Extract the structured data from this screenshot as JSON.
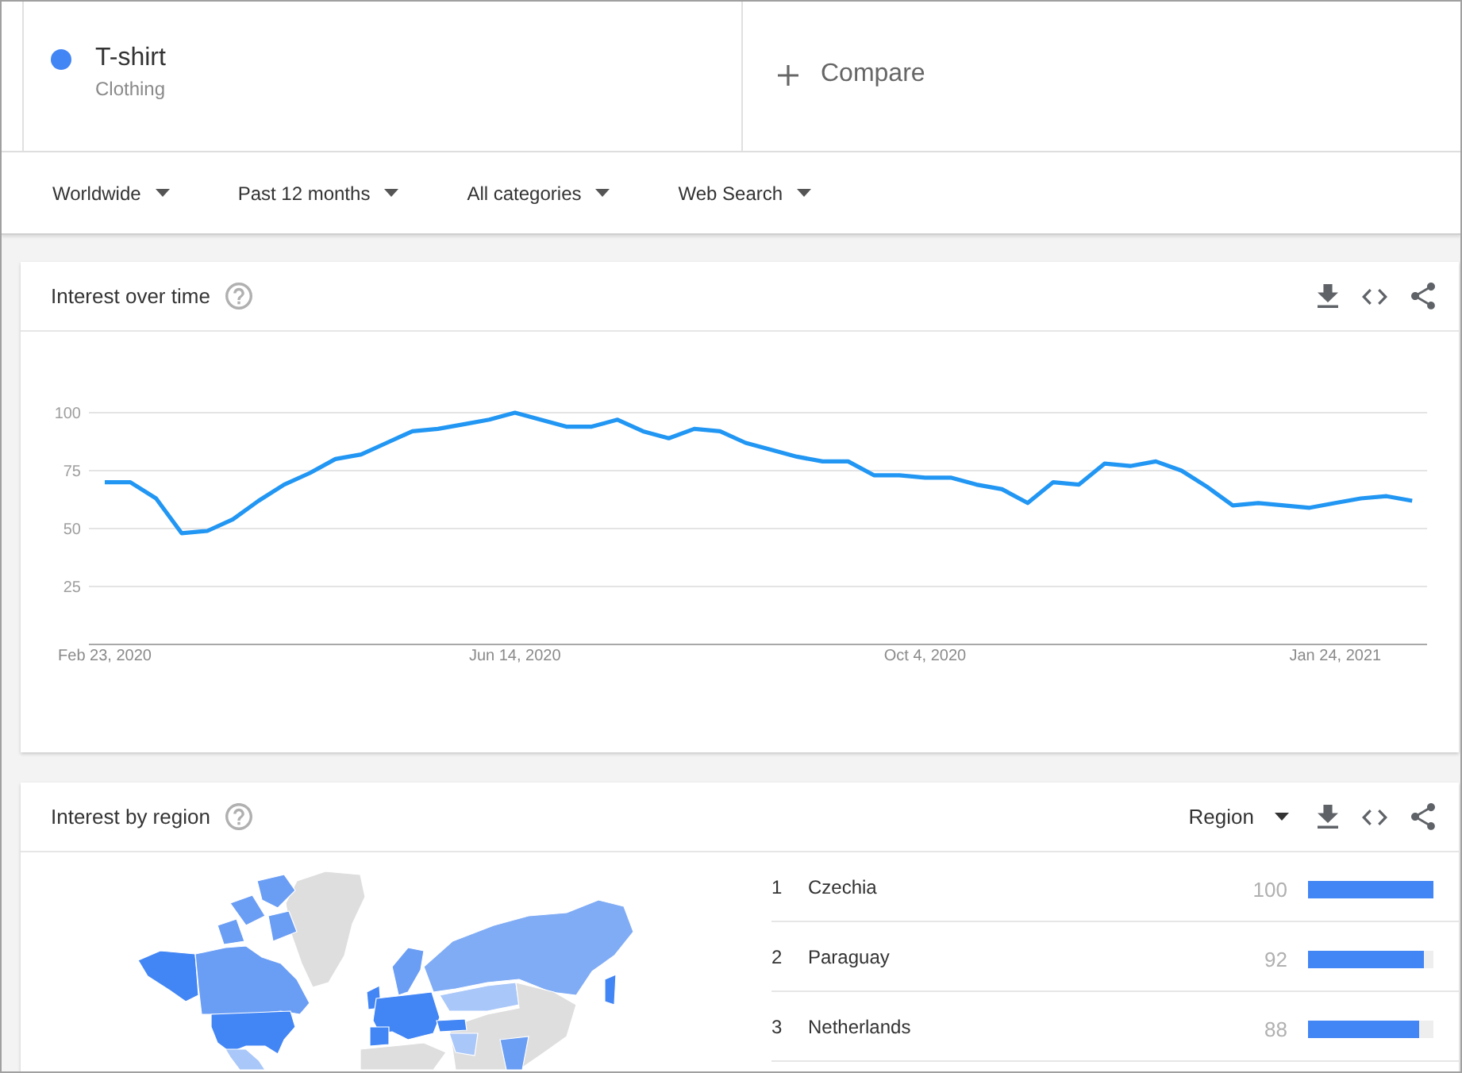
{
  "terms": [
    {
      "name": "T-shirt",
      "category": "Clothing",
      "color": "#4285f4"
    }
  ],
  "compare": {
    "label": "Compare"
  },
  "filters": [
    {
      "label": "Worldwide"
    },
    {
      "label": "Past 12 months"
    },
    {
      "label": "All categories"
    },
    {
      "label": "Web Search"
    }
  ],
  "interest_over_time": {
    "title": "Interest over time",
    "chart_data": {
      "type": "line",
      "grid": true,
      "categories": [
        "Feb 23, 2020",
        null,
        null,
        null,
        null,
        null,
        null,
        null,
        null,
        null,
        null,
        null,
        null,
        null,
        null,
        null,
        "Jun 14, 2020",
        null,
        null,
        null,
        null,
        null,
        null,
        null,
        null,
        null,
        null,
        null,
        null,
        null,
        null,
        null,
        "Oct 4, 2020",
        null,
        null,
        null,
        null,
        null,
        null,
        null,
        null,
        null,
        null,
        null,
        null,
        null,
        null,
        null,
        "Jan 24, 2021",
        null,
        null,
        null
      ],
      "ylim": [
        0,
        100
      ],
      "yticks": [
        25,
        50,
        75,
        100
      ],
      "series": [
        {
          "color": "#2196f3",
          "values": [
            70,
            70,
            63,
            48,
            49,
            54,
            62,
            69,
            74,
            80,
            82,
            87,
            92,
            93,
            95,
            97,
            100,
            97,
            94,
            94,
            97,
            92,
            89,
            93,
            92,
            87,
            84,
            81,
            79,
            79,
            73,
            73,
            72,
            72,
            69,
            67,
            61,
            70,
            69,
            78,
            77,
            79,
            75,
            68,
            60,
            61,
            60,
            59,
            61,
            63,
            64,
            62
          ]
        }
      ]
    }
  },
  "interest_by_region": {
    "title": "Interest by region",
    "resolution": "Region",
    "rows": [
      {
        "rank": "1",
        "name": "Czechia",
        "value": "100",
        "level": 1
      },
      {
        "rank": "2",
        "name": "Paraguay",
        "value": "92",
        "level": 0.92
      },
      {
        "rank": "3",
        "name": "Netherlands",
        "value": "88",
        "level": 0.88
      }
    ]
  }
}
